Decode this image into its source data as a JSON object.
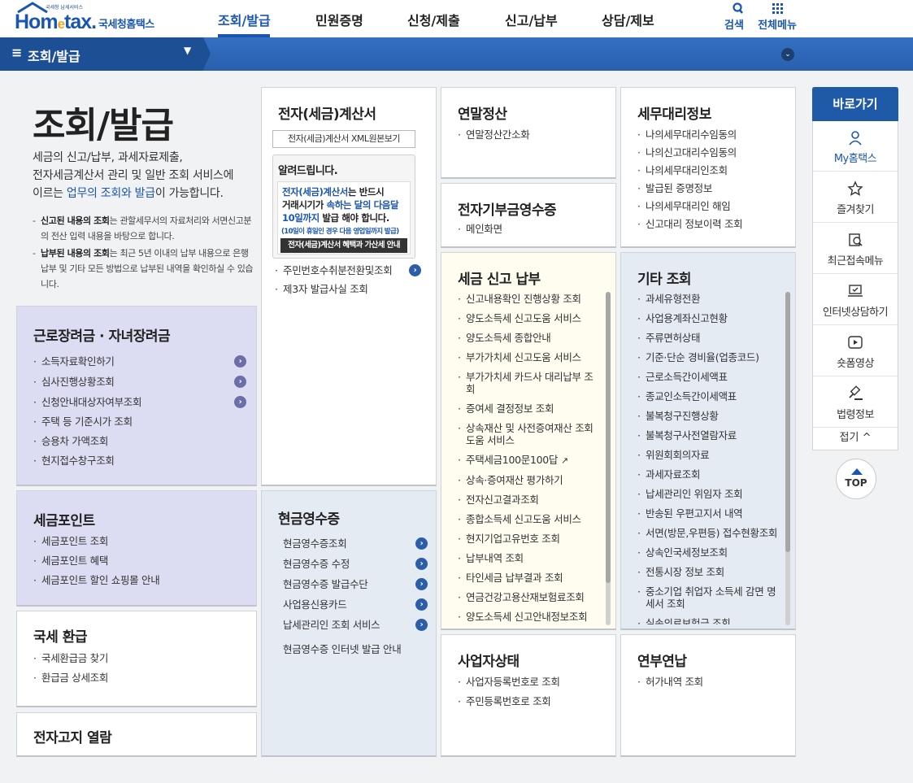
{
  "header": {
    "logo_small": "국세청 납세서비스",
    "logo_brand_pre": "Hom",
    "logo_brand_e": "e",
    "logo_brand_post": "tax.",
    "logo_kor": "국세청홈택스",
    "nav": [
      "조회/발급",
      "민원증명",
      "신청/제출",
      "신고/납부",
      "상담/제보"
    ],
    "search_label": "검색",
    "allmenu_label": "전체메뉴"
  },
  "location": {
    "current": "조회/발급"
  },
  "intro": {
    "title": "조회/발급",
    "desc_1": "세금의 신고/납부, 과세자료제출,",
    "desc_2": "전자세금계산서 관리 및 일반 조회 서비스에",
    "desc_3a": "이르는 ",
    "desc_3b": "업무의 조회와 발급",
    "desc_3c": "이 가능합니다.",
    "note1_bold": "신고된 내용의 조회",
    "note1_text": "는 관할세무서의 자료처리와 서면신고분의 전산 입력 내용을 바탕으로 합니다.",
    "note2_bold": "납부된 내용의 조회",
    "note2_text": "는 최근 5년 이내의 납부 내용으로 은행 납부 및 기타 모든 방법으로 납부된 내역을 확인하실 수 있습니다."
  },
  "boxes": {
    "geunro": {
      "title": "근로장려금 · 자녀장려금",
      "items": [
        "소득자료확인하기",
        "심사진행상황조회",
        "신청안내대상자여부조회",
        "주택 등 기준시가 조회",
        "승용차 가액조회",
        "현지접수창구조회"
      ]
    },
    "point": {
      "title": "세금포인트",
      "items": [
        "세금포인트 조회",
        "세금포인트 혜택",
        "세금포인트 할인 쇼핑몰 안내"
      ]
    },
    "refund": {
      "title": "국세 환급",
      "items": [
        "국세환급금 찾기",
        "환급금 상세조회"
      ]
    },
    "notice_view": {
      "title": "전자고지 열람"
    },
    "einvoice": {
      "title": "전자(세금)계산서",
      "xml_button": "전자(세금)계산서 XML원본보기",
      "notice_title": "알려드립니다.",
      "notice_l1a": "전자(세금)계산서",
      "notice_l1b": "는 반드시",
      "notice_l2a": "거래시기가 ",
      "notice_l2b": "속하는 달의 다음달",
      "notice_l3a": "10일까지",
      "notice_l3b": " 발급 해야 합니다.",
      "notice_sub": "(10일이 휴일인 경우 다음 영업일까지 발급)",
      "notice_btn": "전자(세금)계산서 혜택과 가산세 안내",
      "items": [
        "주민번호수취분전환및조회",
        "제3자 발급사실 조회"
      ]
    },
    "cash": {
      "title": "현금영수증",
      "items": [
        "현금영수증조회",
        "현금영수증 수정",
        "현금영수증 발급수단",
        "사업용신용카드",
        "납세관리인 조회 서비스",
        "현금영수증 인터넷 발급 안내"
      ]
    },
    "yearend": {
      "title": "연말정산",
      "items": [
        "연말정산간소화"
      ]
    },
    "donation": {
      "title": "전자기부금영수증",
      "items": [
        "메인화면"
      ]
    },
    "taxreport": {
      "title": "세금 신고 납부",
      "items": [
        "신고내용확인 진행상황 조회",
        "양도소득세 신고도움 서비스",
        "양도소득세 종합안내",
        "부가가치세 신고도움 서비스",
        "부가가치세 카드사 대리납부 조회",
        "증여세 결정정보 조회",
        "상속재산 및 사전증여재산 조회 도움 서비스",
        "주택세금100문100답",
        "상속·증여재산 평가하기",
        "전자신고결과조회",
        "종합소득세 신고도움 서비스",
        "현지기업고유번호 조회",
        "납부내역 조회",
        "타인세금 납부결과 조회",
        "연금건강고용산재보험료조회",
        "양도소득세 신고안내정보조회"
      ]
    },
    "business": {
      "title": "사업자상태",
      "items": [
        "사업자등록번호로 조회",
        "주민등록번호로 조회"
      ]
    },
    "agent": {
      "title": "세무대리정보",
      "items": [
        "나의세무대리수임동의",
        "나의신고대리수임동의",
        "나의세무대리인조회",
        "발급된 증명정보",
        "나의세무대리인 해임",
        "신고대리 정보이력 조회"
      ]
    },
    "etc": {
      "title": "기타 조회",
      "items": [
        "과세유형전환",
        "사업용계좌신고현황",
        "주류면허상태",
        "기준·단순 경비율(업종코드)",
        "근로소득간이세액표",
        "종교인소득간이세액표",
        "불복청구진행상황",
        "불복청구사전열람자료",
        "위원회회의자료",
        "과세자료조회",
        "납세관리인 위임자 조회",
        "반송된 우편고지서 내역",
        "서면(방문,우편등) 접수현황조회",
        "상속인국세정보조회",
        "전통시장 정보 조회",
        "중소기업 취업자 소득세 감면 명세서 조회",
        "실손의료보험금 조회"
      ]
    },
    "installment": {
      "title": "연부연납",
      "items": [
        "허가내역 조회"
      ]
    }
  },
  "quick": {
    "title": "바로가기",
    "items": [
      "My홈택스",
      "즐겨찾기",
      "최근접속메뉴",
      "인터넷상담하기",
      "숏폼영상",
      "법령정보"
    ],
    "fold": "접기 ^",
    "top": "TOP"
  },
  "colors": {
    "brand": "#1a56b0",
    "logo_accent": "#f4a21d",
    "locbar": "#2a5fae",
    "lavender": "#dcdcf2",
    "cream": "#fffdf0",
    "lightblue": "#e4ebf3"
  }
}
